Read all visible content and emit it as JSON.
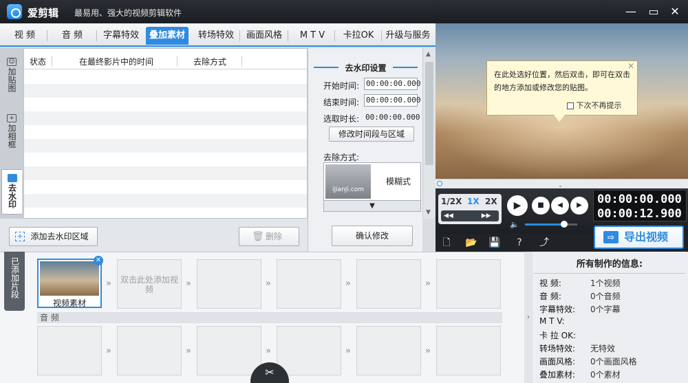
{
  "app": {
    "name": "爱剪辑",
    "slogan": "最易用、强大的视频剪辑软件",
    "window_controls": [
      "minimize-icon",
      "maximize-icon",
      "close-icon"
    ]
  },
  "tabs": [
    {
      "label": "视  频",
      "active": false
    },
    {
      "label": "音  频",
      "active": false
    },
    {
      "label": "字幕特效",
      "active": false
    },
    {
      "label": "叠加素材",
      "active": true
    },
    {
      "label": "转场特效",
      "active": false
    },
    {
      "label": "画面风格",
      "active": false
    },
    {
      "label": "M T V",
      "active": false
    },
    {
      "label": "卡拉OK",
      "active": false
    },
    {
      "label": "升级与服务",
      "active": false
    }
  ],
  "left_nav": [
    {
      "label": "加贴图",
      "icon": "sticker-icon",
      "active": false
    },
    {
      "label": "加相框",
      "icon": "frame-icon",
      "active": false
    },
    {
      "label": "去水印",
      "icon": "watermark-icon",
      "active": true
    }
  ],
  "table": {
    "headers": [
      "状态",
      "在最终影片中的时间",
      "去除方式"
    ],
    "rows": []
  },
  "left_buttons": {
    "add": "添加去水印区域",
    "delete": "删除"
  },
  "watermark_settings": {
    "title": "去水印设置",
    "start_label": "开始时间:",
    "start_value": "00:00:00.000",
    "end_label": "结束时间:",
    "end_value": "00:00:00.000",
    "duration_label": "选取时长:",
    "duration_value": "00:00:00.000",
    "modify_range_button": "修改时间段与区域",
    "method_label": "去除方式:",
    "method_value": "模糊式",
    "preview_watermark": "iJianJi.com",
    "confirm_button": "确认修改"
  },
  "preview": {
    "tooltip_text": "在此处选好位置，然后双击，即可在双击的地方添加或修改您的贴图。",
    "tooltip_checkbox": "下次不再提示"
  },
  "player": {
    "speeds": [
      "1/2X",
      "1X",
      "2X"
    ],
    "active_speed": "1X",
    "current_time": "00:00:00.000",
    "total_time": "00:00:12.900",
    "volume_level": 0.75,
    "export_button": "导出视频"
  },
  "clips": {
    "side_label": "已添加片段",
    "first_clip": "视频素材",
    "empty_hint": "双击此处添加视频",
    "audio_label": "音  频"
  },
  "info": {
    "title": "所有制作的信息:",
    "rows": [
      {
        "label": "视    频:",
        "value": "1个视频"
      },
      {
        "label": "音    频:",
        "value": "0个音频"
      },
      {
        "label": "字幕特效:",
        "value": "0个字幕"
      },
      {
        "label": "M  T  V:",
        "value": ""
      },
      {
        "label": "卡 拉 OK:",
        "value": ""
      },
      {
        "label": "转场特效:",
        "value": "无特效"
      },
      {
        "label": "画面风格:",
        "value": "0个画面风格"
      },
      {
        "label": "叠加素材:",
        "value": "0个素材"
      }
    ]
  },
  "colors": {
    "accent": "#2f8be0",
    "titlebar": "#1a1d21",
    "tooltip_bg": "#fff9d8"
  }
}
